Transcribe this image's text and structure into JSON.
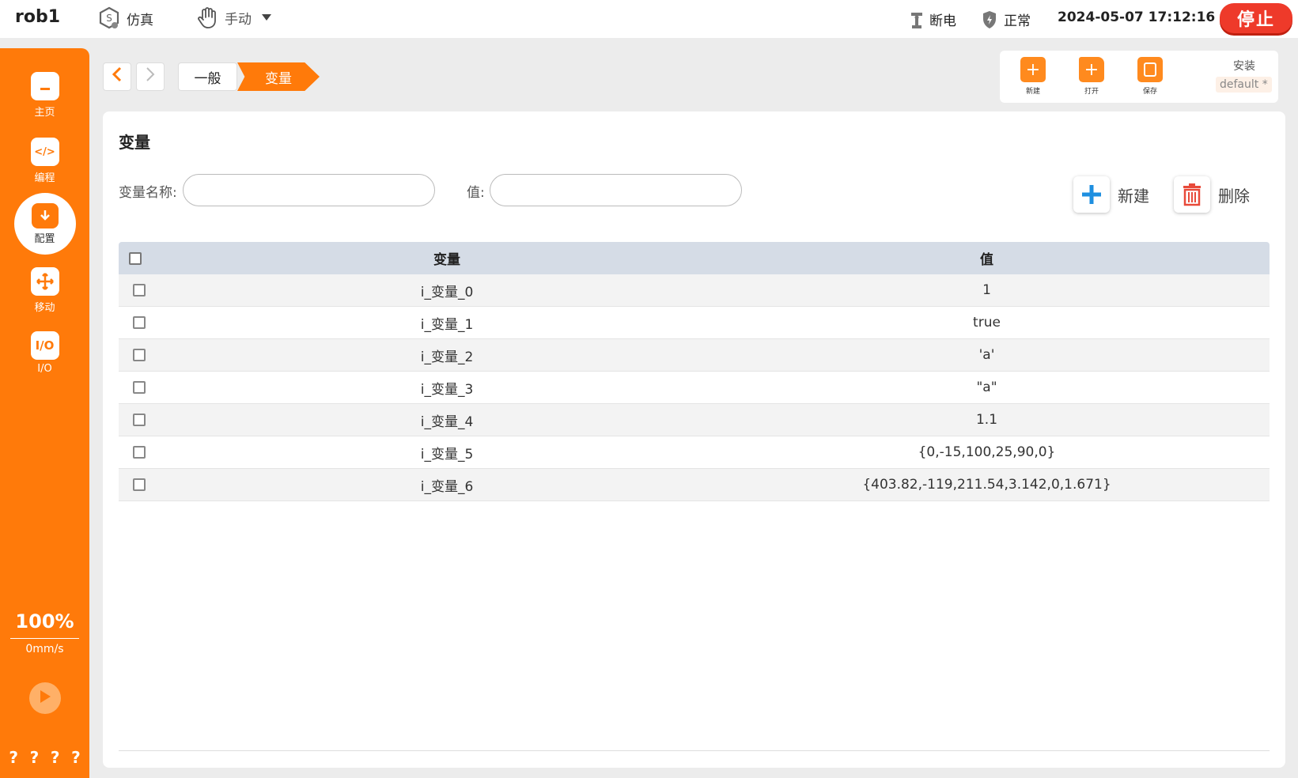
{
  "topbar": {
    "robot_name": "rob1",
    "sim_label": "仿真",
    "mode_label": "手动",
    "power_label": "断电",
    "safety_label": "正常",
    "datetime": "2024-05-07 17:12:16",
    "stop_label": "停止"
  },
  "sidebar": {
    "items": [
      {
        "label": "主页",
        "icon": "home-icon"
      },
      {
        "label": "编程",
        "icon": "code-icon"
      },
      {
        "label": "配置",
        "icon": "config-icon"
      },
      {
        "label": "移动",
        "icon": "move-icon"
      },
      {
        "label": "I/O",
        "icon": "io-icon"
      }
    ],
    "speed_percent": "100%",
    "speed_value": "0mm/s",
    "help": [
      "?",
      "?",
      "?",
      "?"
    ]
  },
  "breadcrumb": {
    "items": [
      "一般",
      "变量"
    ]
  },
  "file_panel": {
    "new_label": "新建",
    "open_label": "打开",
    "save_label": "保存",
    "install_label": "安装",
    "install_value": "default *"
  },
  "main": {
    "title": "变量",
    "name_filter_label": "变量名称:",
    "name_filter_value": "",
    "value_filter_label": "值:",
    "value_filter_value": "",
    "new_button": "新建",
    "delete_button": "删除"
  },
  "table": {
    "columns": [
      "变量",
      "值"
    ],
    "rows": [
      {
        "name": "i_变量_0",
        "value": "1"
      },
      {
        "name": "i_变量_1",
        "value": "true"
      },
      {
        "name": "i_变量_2",
        "value": "'a'"
      },
      {
        "name": "i_变量_3",
        "value": "\"a\""
      },
      {
        "name": "i_变量_4",
        "value": "1.1"
      },
      {
        "name": "i_变量_5",
        "value": "{0,-15,100,25,90,0}"
      },
      {
        "name": "i_变量_6",
        "value": "{403.82,-119,211.54,3.142,0,1.671}"
      }
    ]
  },
  "colors": {
    "accent": "#ff7a0a",
    "stop": "#ee3a2a",
    "header_row": "#d5dce6"
  }
}
